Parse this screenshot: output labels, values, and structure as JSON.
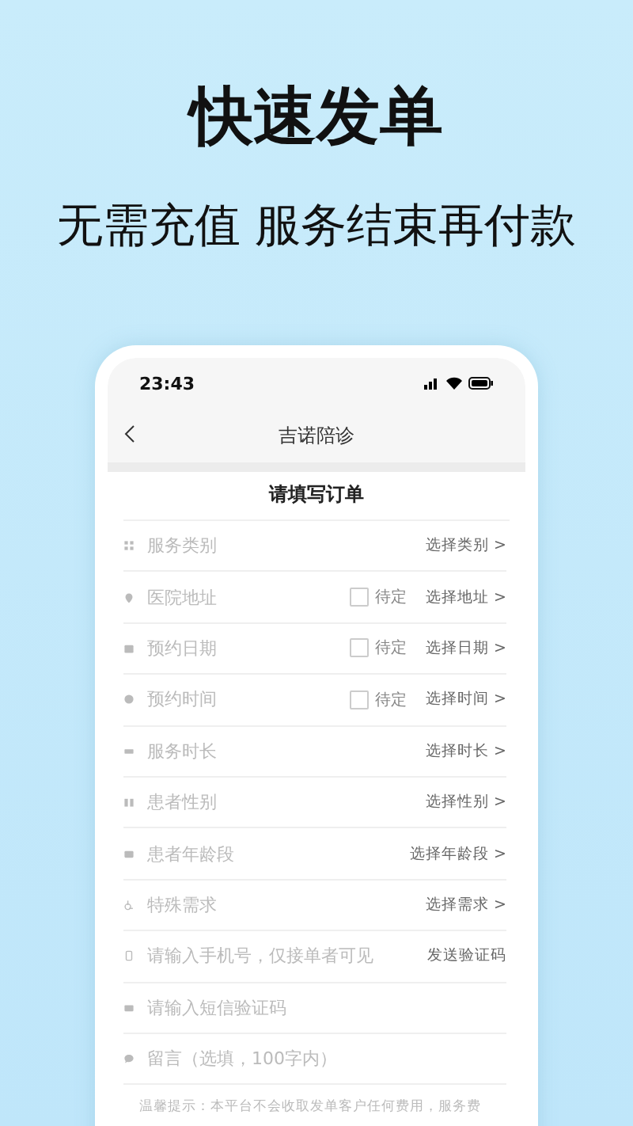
{
  "headline": "快速发单",
  "subheadline": "无需充值 服务结束再付款",
  "phone": {
    "status_bar": {
      "time": "23:43"
    },
    "nav": {
      "title": "吉诺陪诊"
    },
    "form": {
      "title": "请填写订单",
      "rows": [
        {
          "kind": "select",
          "label": "服务类别",
          "action": "选择类别 >"
        },
        {
          "kind": "select",
          "label": "医院地址",
          "pending": {
            "label": "待定",
            "checked": false
          },
          "action": "选择地址 >"
        },
        {
          "kind": "select",
          "label": "预约日期",
          "pending": {
            "label": "待定",
            "checked": false
          },
          "action": "选择日期 >"
        },
        {
          "kind": "select",
          "label": "预约时间",
          "pending": {
            "label": "待定",
            "checked": false
          },
          "action": "选择时间 >"
        },
        {
          "kind": "select",
          "label": "服务时长",
          "action": "选择时长 >"
        },
        {
          "kind": "select",
          "label": "患者性别",
          "action": "选择性别 >"
        },
        {
          "kind": "select",
          "label": "患者年龄段",
          "action": "选择年龄段 >"
        },
        {
          "kind": "select",
          "label": "特殊需求",
          "action": "选择需求 >"
        },
        {
          "kind": "input",
          "placeholder": "请输入手机号，仅接单者可见",
          "action": "发送验证码"
        },
        {
          "kind": "input",
          "placeholder": "请输入短信验证码"
        },
        {
          "kind": "input",
          "placeholder": "留言（选填，100字内）"
        }
      ],
      "tip": "温馨提示：本平台不会收取发单客户任何费用，服务费"
    }
  }
}
